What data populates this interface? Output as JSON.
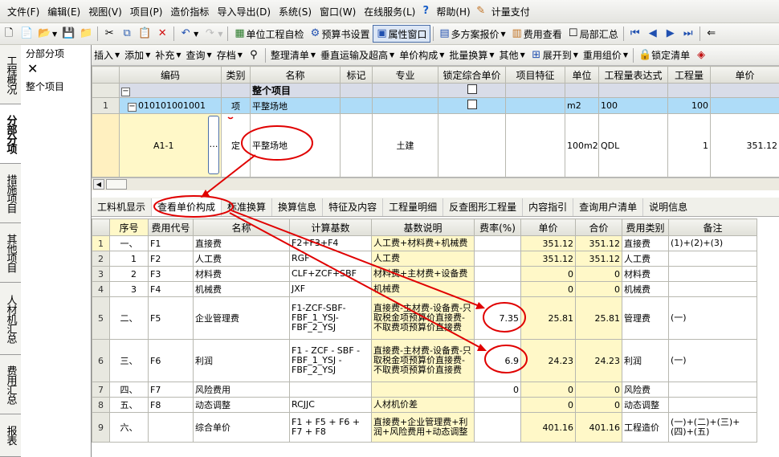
{
  "menu": [
    "文件(F)",
    "编辑(E)",
    "视图(V)",
    "项目(P)",
    "造价指标",
    "导入导出(D)",
    "系统(S)",
    "窗口(W)",
    "在线服务(L)",
    "帮助(H)",
    "计量支付"
  ],
  "toolbar1": {
    "check": "单位工程自检",
    "budget": "预算书设置",
    "attr": "属性窗口",
    "multi": "多方案报价",
    "fee": "费用查看",
    "local": "局部汇总"
  },
  "toolbar2": [
    "插入",
    "添加",
    "补充",
    "查询",
    "存档",
    "整理清单",
    "垂直运输及超高",
    "单价构成",
    "批量换算",
    "其他",
    "展开到",
    "重用组价",
    "锁定清单"
  ],
  "vtabs": [
    "工程概况",
    "分部分项",
    "措施项目",
    "其他项目",
    "人材机汇总",
    "费用汇总",
    "报表"
  ],
  "nav": {
    "title": "分部分项",
    "item": "整个项目"
  },
  "main": {
    "headers": [
      "编码",
      "类别",
      "名称",
      "标记",
      "专业",
      "锁定综合单价",
      "项目特征",
      "单位",
      "工程量表达式",
      "工程量",
      "单价"
    ],
    "whole": {
      "name": "整个项目"
    },
    "row1": {
      "num": "1",
      "code": "010101001001",
      "type": "项",
      "name": "平整场地",
      "unit": "m2",
      "expr": "100",
      "qty": "100"
    },
    "sub": {
      "code": "A1-1",
      "btn": "…",
      "type": "定",
      "name": "平整场地",
      "major": "土建",
      "unit": "100m2",
      "expr": "QDL",
      "qty": "1",
      "price": "351.12"
    }
  },
  "tabs": [
    "工料机显示",
    "查看单价构成",
    "标准换算",
    "换算信息",
    "特征及内容",
    "工程量明细",
    "反查图形工程量",
    "内容指引",
    "查询用户清单",
    "说明信息"
  ],
  "sub": {
    "headers": [
      "序号",
      "费用代号",
      "名称",
      "计算基数",
      "基数说明",
      "费率(%)",
      "单价",
      "合价",
      "费用类别",
      "备注"
    ],
    "rows": [
      {
        "n": "1",
        "seq": "一、",
        "code": "F1",
        "name": "直接费",
        "base": "F2+F3+F4",
        "desc": "人工费+材料费+机械费",
        "rate": "",
        "price": "351.12",
        "total": "351.12",
        "cat": "直接费",
        "note": "(1)+(2)+(3)"
      },
      {
        "n": "2",
        "seq": "1",
        "code": "F2",
        "name": "人工费",
        "base": "RGF",
        "desc": "人工费",
        "rate": "",
        "price": "351.12",
        "total": "351.12",
        "cat": "人工费",
        "note": ""
      },
      {
        "n": "3",
        "seq": "2",
        "code": "F3",
        "name": "材料费",
        "base": "CLF+ZCF+SBF",
        "desc": "材料费+主材费+设备费",
        "rate": "",
        "price": "0",
        "total": "0",
        "cat": "材料费",
        "note": ""
      },
      {
        "n": "4",
        "seq": "3",
        "code": "F4",
        "name": "机械费",
        "base": "JXF",
        "desc": "机械费",
        "rate": "",
        "price": "0",
        "total": "0",
        "cat": "机械费",
        "note": ""
      },
      {
        "n": "5",
        "seq": "二、",
        "code": "F5",
        "name": "企业管理费",
        "base": "F1-ZCF-SBF-FBF_1_YSJ-FBF_2_YSJ",
        "desc": "直接费-主材费-设备费-只取税金项预算价直接费-不取费项预算价直接费",
        "rate": "7.35",
        "price": "25.81",
        "total": "25.81",
        "cat": "管理费",
        "note": "(一)"
      },
      {
        "n": "6",
        "seq": "三、",
        "code": "F6",
        "name": "利润",
        "base": "F1 - ZCF - SBF - FBF_1_YSJ - FBF_2_YSJ",
        "desc": "直接费-主材费-设备费-只取税金项预算价直接费-不取费项预算价直接费",
        "rate": "6.9",
        "price": "24.23",
        "total": "24.23",
        "cat": "利润",
        "note": "(一)"
      },
      {
        "n": "7",
        "seq": "四、",
        "code": "F7",
        "name": "风险费用",
        "base": "",
        "desc": "",
        "rate": "0",
        "price": "0",
        "total": "0",
        "cat": "风险费",
        "note": ""
      },
      {
        "n": "8",
        "seq": "五、",
        "code": "F8",
        "name": "动态调整",
        "base": "RCJJC",
        "desc": "人材机价差",
        "rate": "",
        "price": "0",
        "total": "0",
        "cat": "动态调整",
        "note": ""
      },
      {
        "n": "9",
        "seq": "六、",
        "code": "",
        "name": "综合单价",
        "base": "F1 + F5 + F6 + F7 + F8",
        "desc": "直接费+企业管理费+利润+风险费用+动态调整",
        "rate": "",
        "price": "401.16",
        "total": "401.16",
        "cat": "工程造价",
        "note": "(一)+(二)+(三)+(四)+(五)"
      }
    ]
  },
  "colors": {
    "highlight": "#aedcf8",
    "priceBg": "#fff8c8",
    "annotation": "#e00000"
  }
}
